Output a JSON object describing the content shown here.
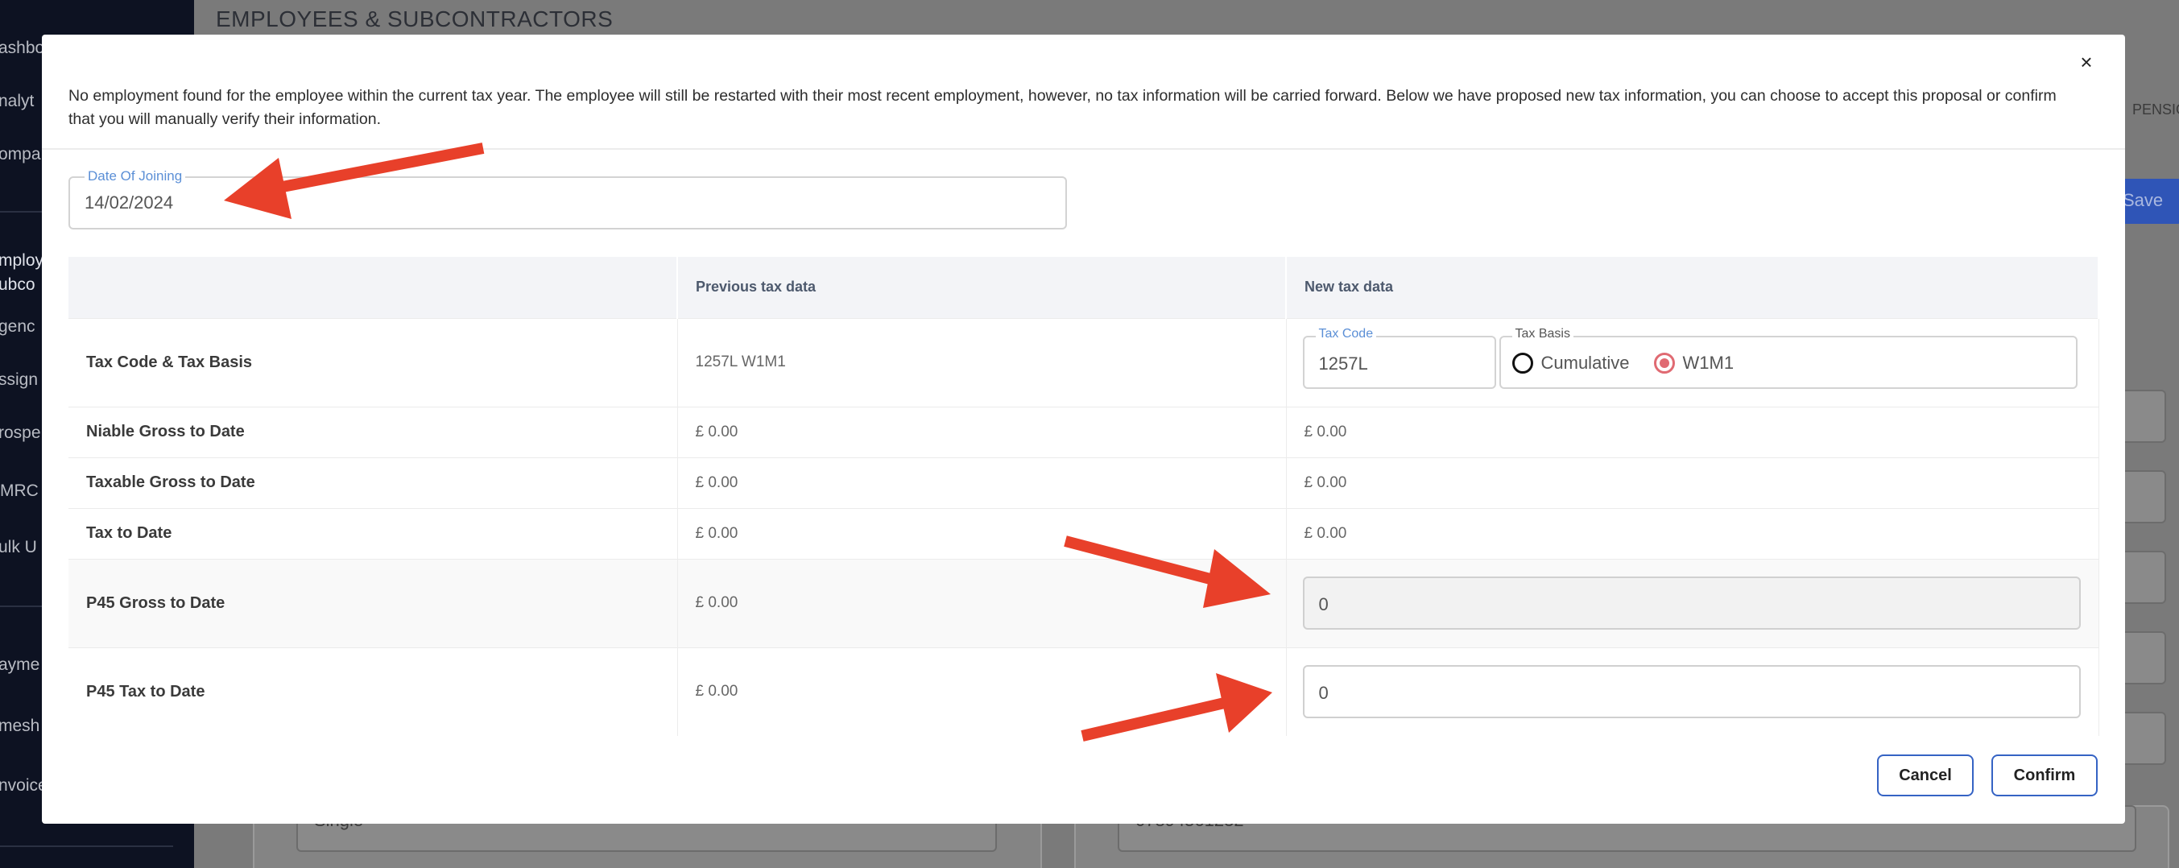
{
  "app": {
    "page_title": "EMPLOYEES & SUBCONTRACTORS",
    "sidebar_items": [
      "ashbo",
      "nalyt",
      "ompa",
      "mploy",
      "ubco",
      "genc",
      "ssign",
      "rospe",
      "MRC",
      "ulk U",
      "ayme",
      "mesh",
      "nvoice"
    ],
    "tab_fragment": "PENSIO",
    "save_label": "Save",
    "bg_select_value": "Single",
    "bg_phone_value": "07894561232"
  },
  "modal": {
    "notice": "No employment found for the employee within the current tax year. The employee will still be restarted with their most recent employment, however, no tax information will be carried forward. Below we have proposed new tax information, you can choose to accept this proposal or confirm that you will manually verify their information.",
    "close_label": "X",
    "date_of_joining": {
      "label": "Date Of Joining",
      "value": "14/02/2024"
    },
    "table": {
      "headers": [
        "",
        "Previous tax data",
        "New tax data"
      ],
      "rows": [
        {
          "label": "Tax Code & Tax Basis",
          "previous": "1257L W1M1"
        },
        {
          "label": "Niable Gross to Date",
          "previous": "£ 0.00",
          "new": "£ 0.00"
        },
        {
          "label": "Taxable Gross to Date",
          "previous": "£ 0.00",
          "new": "£ 0.00"
        },
        {
          "label": "Tax to Date",
          "previous": "£ 0.00",
          "new": "£ 0.00"
        },
        {
          "label": "P45 Gross to Date",
          "previous": "£ 0.00",
          "new": "0"
        },
        {
          "label": "P45 Tax to Date",
          "previous": "£ 0.00",
          "new": "0"
        }
      ]
    },
    "tax_code": {
      "label": "Tax Code",
      "value": "1257L"
    },
    "tax_basis": {
      "label": "Tax Basis",
      "options": [
        "Cumulative",
        "W1M1"
      ],
      "selected": "W1M1"
    },
    "buttons": {
      "cancel": "Cancel",
      "confirm": "Confirm"
    }
  },
  "colors": {
    "accent": "#3563c4",
    "label_blue": "#5b8fd6",
    "radio_checked": "#e06a72",
    "arrow": "#e8402a"
  }
}
